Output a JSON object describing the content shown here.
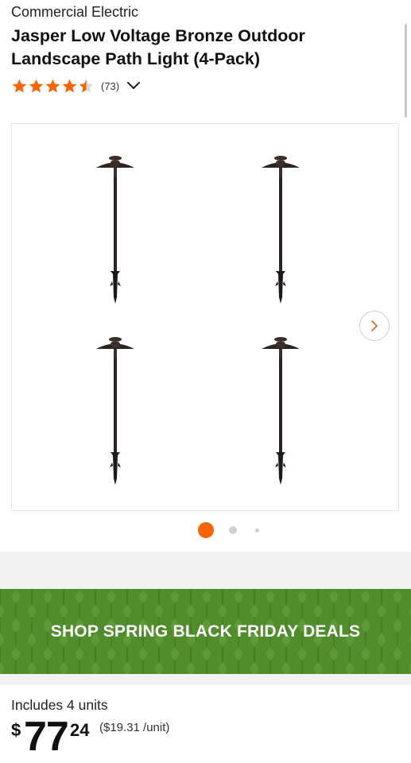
{
  "product": {
    "brand": "Commercial Electric",
    "title": "Jasper Low Voltage Bronze Outdoor Landscape Path Light (4-Pack)",
    "rating": 4.5,
    "rating_max": 5,
    "review_count": "(73)"
  },
  "gallery": {
    "image_description_icon": "path-light-icon",
    "light_count": 4,
    "current_slide": 1,
    "total_slides": 3
  },
  "promo": {
    "label": "SHOP SPRING BLACK FRIDAY DEALS",
    "background_color": "#4f8e2a"
  },
  "pricing": {
    "units_text": "Includes 4 units",
    "currency_symbol": "$",
    "price_whole": "77",
    "price_cents": "24",
    "unit_price": "($19.31 /unit)"
  },
  "colors": {
    "accent": "#f96302",
    "star": "#f96302"
  }
}
